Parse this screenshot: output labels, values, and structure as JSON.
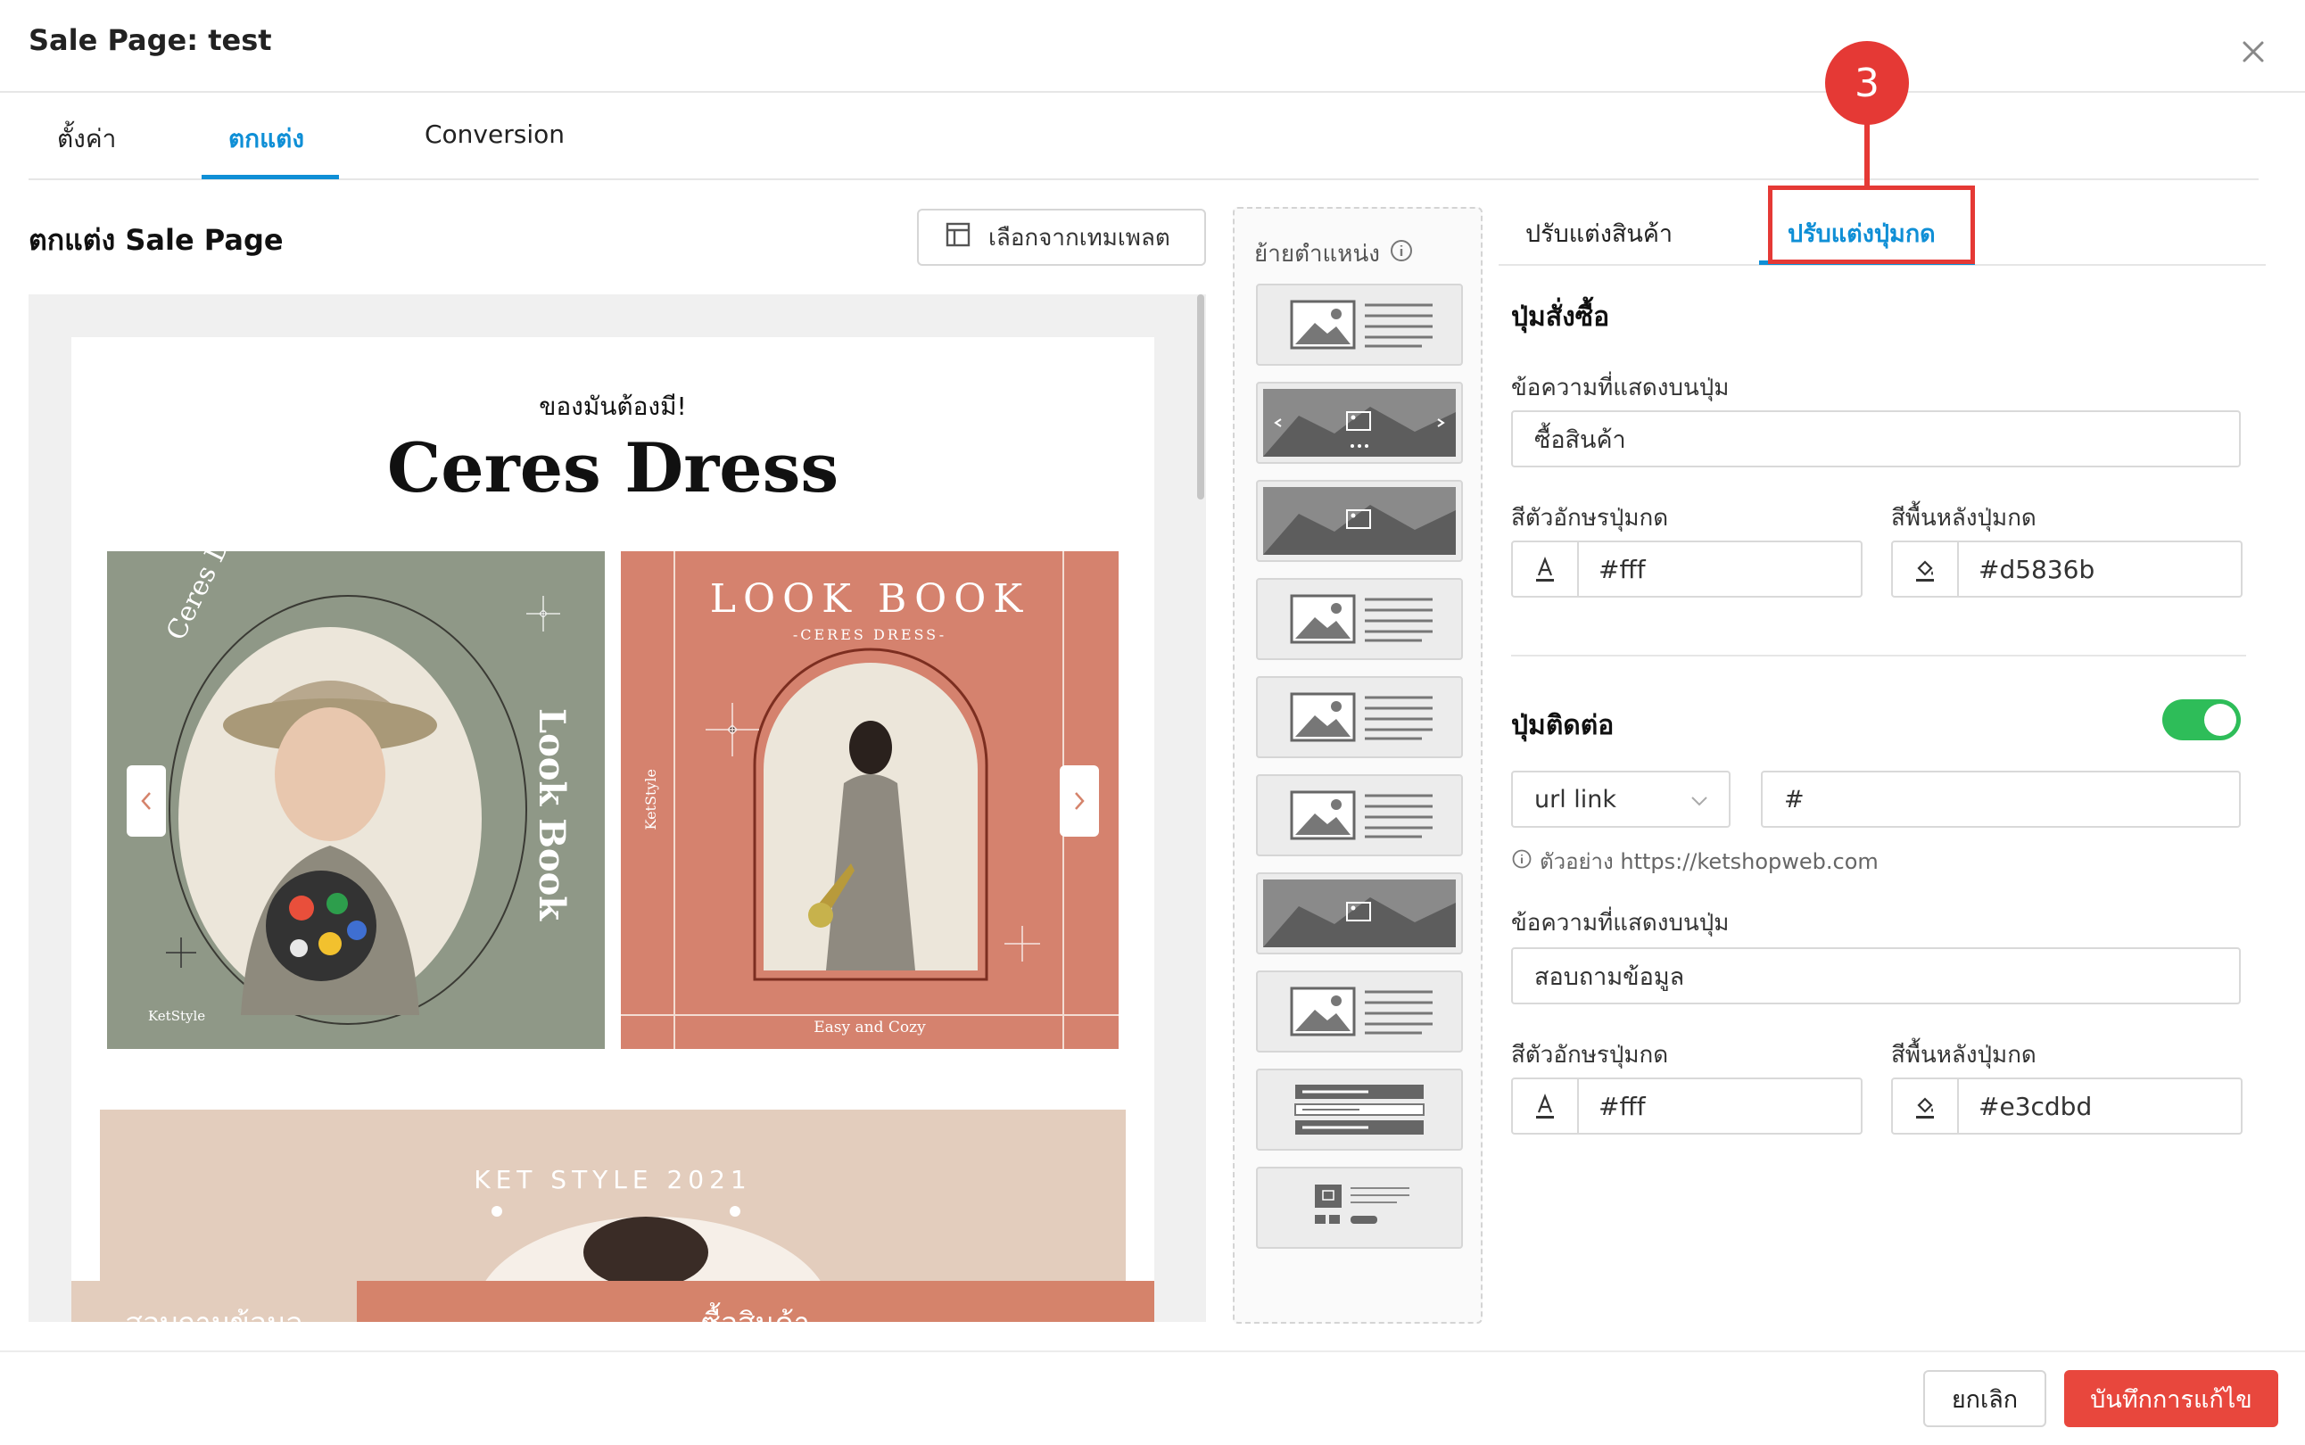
{
  "dialog": {
    "title": "Sale Page: test"
  },
  "tabs": [
    {
      "label": "ตั้งค่า",
      "active": false
    },
    {
      "label": "ตกแต่ง",
      "active": true
    },
    {
      "label": "Conversion",
      "active": false
    }
  ],
  "editor": {
    "section_title": "ตกแต่ง Sale Page",
    "template_button_label": "เลือกจากเทมเพลต"
  },
  "preview": {
    "kicker": "ของมันต้องมี!",
    "product_title": "Ceres Dress",
    "slide_1": {
      "curved_text": "Ceres Dress",
      "side_text": "Look Book",
      "brand": "KetStyle"
    },
    "slide_2": {
      "heading": "LOOK BOOK",
      "subheading": "-CERES DRESS-",
      "side_text": "KetStyle",
      "footer_text": "Easy and Cozy"
    },
    "banner_text": "KET STYLE 2021",
    "contact_button": "สอบถามข้อมูล",
    "buy_button": "ซื้อสินค้า"
  },
  "block_strip": {
    "title": "ย้ายตำแหน่ง",
    "blocks": [
      "image-text",
      "slider",
      "banner",
      "image-text",
      "image-text",
      "image-text",
      "banner",
      "image-text",
      "text-list",
      "product-card"
    ]
  },
  "settings": {
    "tabs": [
      {
        "label": "ปรับแต่งสินค้า",
        "active": false
      },
      {
        "label": "ปรับแต่งปุ่มกด",
        "active": true
      }
    ],
    "callout_number": "3",
    "buy_button": {
      "heading": "ปุ่มสั่งซื้อ",
      "text_label": "ข้อความที่แสดงบนปุ่ม",
      "text_value": "ซื้อสินค้า",
      "text_color_label": "สีตัวอักษรปุ่มกด",
      "text_color_value": "#fff",
      "bg_color_label": "สีพื้นหลังปุ่มกด",
      "bg_color_value": "#d5836b"
    },
    "contact_button": {
      "heading": "ปุ่มติดต่อ",
      "enabled": true,
      "link_type": "url link",
      "link_value": "#",
      "hint": "ตัวอย่าง https://ketshopweb.com",
      "text_label": "ข้อความที่แสดงบนปุ่ม",
      "text_value": "สอบถามข้อมูล",
      "text_color_label": "สีตัวอักษรปุ่มกด",
      "text_color_value": "#fff",
      "bg_color_label": "สีพื้นหลังปุ่มกด",
      "bg_color_value": "#e3cdbd"
    }
  },
  "footer": {
    "cancel_label": "ยกเลิก",
    "save_label": "บันทึกการแก้ไข"
  },
  "colors": {
    "accent": "#0f8fd6",
    "save": "#e8473d",
    "toggle_on": "#2ebd59",
    "callout": "#e53935"
  }
}
